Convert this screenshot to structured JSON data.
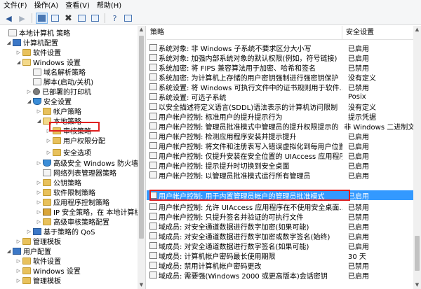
{
  "menu": [
    "文件(F)",
    "操作(A)",
    "查看(V)",
    "帮助(H)"
  ],
  "toolbar": {
    "buttons": [
      "back-icon",
      "forward-icon",
      "show-tree-icon",
      "console-icon",
      "delete-icon",
      "properties-icon",
      "export-icon",
      "help-icon",
      "panel-icon"
    ]
  },
  "tree": {
    "nodes": [
      {
        "label": "本地计算机 策略",
        "exp": "",
        "icon": "pc-icon"
      },
      {
        "label": "计算机配置",
        "exp": "◢",
        "icon": "pc-icon"
      },
      {
        "label": "软件设置",
        "exp": "▷",
        "icon": "folder-icon"
      },
      {
        "label": "Windows 设置",
        "exp": "◢",
        "icon": "folder-icon"
      },
      {
        "label": "域名解析策略",
        "exp": "",
        "icon": "doc-icon"
      },
      {
        "label": "脚本(启动/关机)",
        "exp": "",
        "icon": "doc-icon"
      },
      {
        "label": "已部署的打印机",
        "exp": "▷",
        "icon": "printer-icon"
      },
      {
        "label": "安全设置",
        "exp": "◢",
        "icon": "shield-icon"
      },
      {
        "label": "帐户策略",
        "exp": "▷",
        "icon": "folder-icon"
      },
      {
        "label": "本地策略",
        "exp": "◢",
        "icon": "folder-icon"
      },
      {
        "label": "审核策略",
        "exp": "▷",
        "icon": "folder-icon"
      },
      {
        "label": "用户权限分配",
        "exp": "▷",
        "icon": "folder-icon"
      },
      {
        "label": "安全选项",
        "exp": "▷",
        "icon": "folder-icon"
      },
      {
        "label": "高级安全 Windows 防火墙",
        "exp": "▷",
        "icon": "firewall-icon"
      },
      {
        "label": "网络列表管理器策略",
        "exp": "",
        "icon": "doc-icon"
      },
      {
        "label": "公钥策略",
        "exp": "▷",
        "icon": "folder-icon"
      },
      {
        "label": "软件限制策略",
        "exp": "▷",
        "icon": "folder-icon"
      },
      {
        "label": "应用程序控制策略",
        "exp": "▷",
        "icon": "folder-icon"
      },
      {
        "label": "IP 安全策略，在 本地计算机",
        "exp": "▷",
        "icon": "ipsec-icon"
      },
      {
        "label": "高级审核策略配置",
        "exp": "▷",
        "icon": "folder-icon"
      },
      {
        "label": "基于策略的 QoS",
        "exp": "▷",
        "icon": "qos-icon"
      },
      {
        "label": "管理模板",
        "exp": "▷",
        "icon": "folder-icon"
      },
      {
        "label": "用户配置",
        "exp": "◢",
        "icon": "user-icon"
      },
      {
        "label": "软件设置",
        "exp": "▷",
        "icon": "folder-icon"
      },
      {
        "label": "Windows 设置",
        "exp": "▷",
        "icon": "folder-icon"
      },
      {
        "label": "管理模板",
        "exp": "▷",
        "icon": "folder-icon"
      }
    ]
  },
  "list": {
    "col_policy": "策略",
    "col_setting": "安全设置",
    "rows": [
      {
        "policy": "系统对象: 非 Windows 子系统不要求区分大小写",
        "setting": "已启用"
      },
      {
        "policy": "系统对象: 加强内部系统对象的默认权限(例如，符号链接)",
        "setting": "已启用"
      },
      {
        "policy": "系统加密: 将 FIPS 兼容算法用于加密、哈希和签名",
        "setting": "已禁用"
      },
      {
        "policy": "系统加密: 为计算机上存储的用户密钥强制进行强密钥保护",
        "setting": "没有定义"
      },
      {
        "policy": "系统设置: 将 Windows 可执行文件中的证书规则用于软件...",
        "setting": "已禁用"
      },
      {
        "policy": "系统设置: 可选子系统",
        "setting": "Posix"
      },
      {
        "policy": "以安全描述符定义语言(SDDL)语法表示的计算机访问限制",
        "setting": "没有定义"
      },
      {
        "policy": "用户帐户控制: 标准用户的提升提示行为",
        "setting": "提示凭据"
      },
      {
        "policy": "用户帐户控制: 管理员批准模式中管理员的提升权限提示的...",
        "setting": "非 Windows 二进制文"
      },
      {
        "policy": "用户帐户控制: 检测应用程序安装并提示提升",
        "setting": "已启用"
      },
      {
        "policy": "用户帐户控制: 将文件和注册表写入错误虚拟化到每用户位置",
        "setting": "已启用"
      },
      {
        "policy": "用户帐户控制: 仅提升安装在安全位置的 UIAccess 应用程序",
        "setting": "已启用"
      },
      {
        "policy": "用户帐户控制: 提示提升时切换到安全桌面",
        "setting": "已启用"
      },
      {
        "policy": "用户帐户控制: 以管理员批准模式运行所有管理员",
        "setting": "已启用"
      },
      {
        "policy": "用户帐户控制: 用于内置管理员帐户的管理员批准模式",
        "setting": "已启用",
        "selected": true
      },
      {
        "policy": "用户帐户控制: 允许 UIAccess 应用程序在不使用安全桌面...",
        "setting": "已禁用"
      },
      {
        "policy": "用户帐户控制: 只提升签名并验证的可执行文件",
        "setting": "已禁用"
      },
      {
        "policy": "域成员: 对安全通道数据进行数字加密(如果可能)",
        "setting": "已启用"
      },
      {
        "policy": "域成员: 对安全通道数据进行数字加密或数字签名(始终)",
        "setting": "已启用"
      },
      {
        "policy": "域成员: 对安全通道数据进行数字签名(如果可能)",
        "setting": "已启用"
      },
      {
        "policy": "域成员: 计算机帐户密码最长使用期限",
        "setting": "30 天"
      },
      {
        "policy": "域成员: 禁用计算机帐户密码更改",
        "setting": "已禁用"
      },
      {
        "policy": "域成员: 需要强(Windows 2000 或更高版本)会话密钥",
        "setting": "已启用"
      }
    ]
  }
}
